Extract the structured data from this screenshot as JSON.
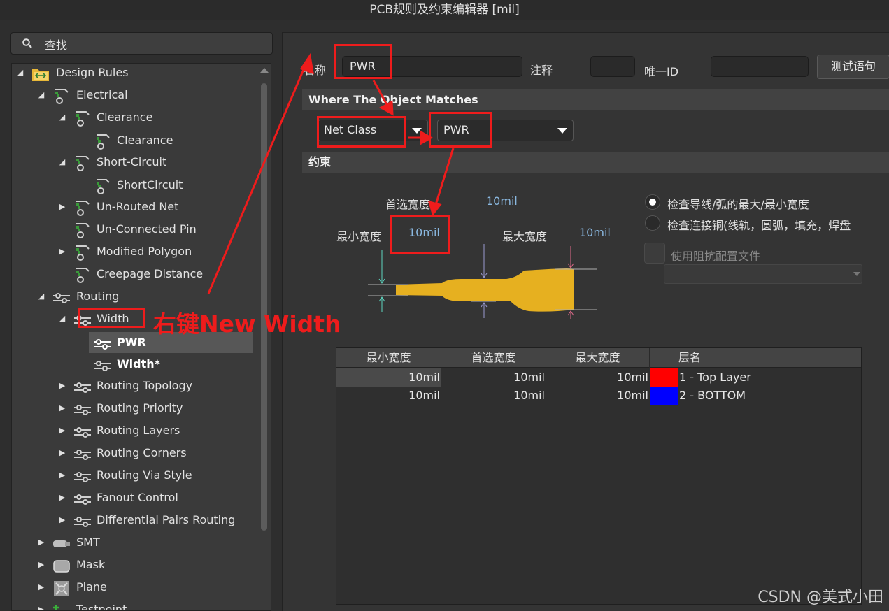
{
  "window": {
    "title": "PCB规则及约束编辑器 [mil]"
  },
  "search": {
    "label": "查找"
  },
  "tree": {
    "items": [
      {
        "label": "Design Rules",
        "arrow": "◢"
      },
      {
        "label": "Electrical",
        "arrow": "◢"
      },
      {
        "label": "Clearance",
        "arrow": "◢"
      },
      {
        "label": "Clearance",
        "arrow": ""
      },
      {
        "label": "Short-Circuit",
        "arrow": "◢"
      },
      {
        "label": "ShortCircuit",
        "arrow": ""
      },
      {
        "label": "Un-Routed Net",
        "arrow": "▶"
      },
      {
        "label": "Un-Connected Pin",
        "arrow": ""
      },
      {
        "label": "Modified Polygon",
        "arrow": "▶"
      },
      {
        "label": "Creepage Distance",
        "arrow": ""
      },
      {
        "label": "Routing",
        "arrow": "◢"
      },
      {
        "label": "Width",
        "arrow": "◢"
      },
      {
        "label": "PWR",
        "arrow": ""
      },
      {
        "label": "Width*",
        "arrow": ""
      },
      {
        "label": "Routing Topology",
        "arrow": "▶"
      },
      {
        "label": "Routing Priority",
        "arrow": "▶"
      },
      {
        "label": "Routing Layers",
        "arrow": "▶"
      },
      {
        "label": "Routing Corners",
        "arrow": "▶"
      },
      {
        "label": "Routing Via Style",
        "arrow": "▶"
      },
      {
        "label": "Fanout Control",
        "arrow": "▶"
      },
      {
        "label": "Differential Pairs Routing",
        "arrow": "▶"
      },
      {
        "label": "SMT",
        "arrow": "▶"
      },
      {
        "label": "Mask",
        "arrow": "▶"
      },
      {
        "label": "Plane",
        "arrow": "▶"
      },
      {
        "label": "Testpoint",
        "arrow": "▶"
      }
    ]
  },
  "rule": {
    "name_label": "名称",
    "name_value": "PWR",
    "comment_label": "注释",
    "comment_value": "",
    "uid_label": "唯一ID",
    "uid_value": "",
    "test_button": "测试语句"
  },
  "where": {
    "header": "Where The Object Matches",
    "type_value": "Net Class",
    "class_value": "PWR"
  },
  "constraints": {
    "header": "约束",
    "preferred_label": "首选宽度",
    "preferred_value": "10mil",
    "min_label": "最小宽度",
    "min_value": "10mil",
    "max_label": "最大宽度",
    "max_value": "10mil",
    "radio1": "检查导线/弧的最大/最小宽度",
    "radio2": "检查连接铜(线轨，圆弧，填充，焊盘",
    "impedance_label": "使用阻抗配置文件"
  },
  "table": {
    "headers": [
      "最小宽度",
      "首选宽度",
      "最大宽度",
      "",
      "层名"
    ],
    "rows": [
      {
        "min": "10mil",
        "pref": "10mil",
        "max": "10mil",
        "color": "#ff0000",
        "layer": "1 - Top Layer"
      },
      {
        "min": "10mil",
        "pref": "10mil",
        "max": "10mil",
        "color": "#0000ff",
        "layer": "2 - BOTTOM"
      }
    ]
  },
  "annotation": {
    "text": "右键New Width"
  },
  "watermark": "CSDN @美式小田",
  "colors": {
    "accent_red": "#ee1c1c",
    "track_yellow": "#e6b020",
    "value_blue": "#8ab8e0"
  }
}
